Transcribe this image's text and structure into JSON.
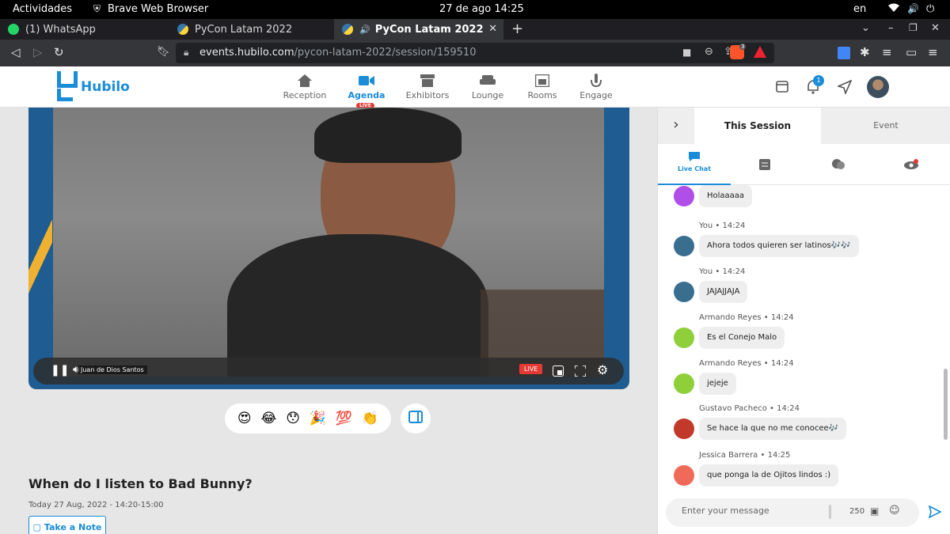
{
  "system": {
    "activities": "Actividades",
    "app_name": "Brave Web Browser",
    "datetime": "27 de ago  14:25",
    "lang": "en"
  },
  "browser": {
    "tabs": [
      {
        "title": "(1) WhatsApp"
      },
      {
        "title": "PyCon Latam 2022"
      },
      {
        "title": "PyCon Latam 2022"
      }
    ],
    "url_host": "events.hubilo.com",
    "url_path": "/pycon-latam-2022/session/159510",
    "brave_badge": "3"
  },
  "app": {
    "logo": "Hubilo",
    "nav": [
      {
        "label": "Reception",
        "icon": "home-icon"
      },
      {
        "label": "Agenda",
        "icon": "video-camera-icon",
        "badge": "LIVE"
      },
      {
        "label": "Exhibitors",
        "icon": "store-icon"
      },
      {
        "label": "Lounge",
        "icon": "sofa-icon"
      },
      {
        "label": "Rooms",
        "icon": "rooms-icon"
      },
      {
        "label": "Engage",
        "icon": "engage-icon"
      }
    ],
    "notification_count": "1"
  },
  "video": {
    "speaker_name": "Juan de Dios Santos",
    "live_label": "LIVE"
  },
  "reactions": [
    "😍",
    "😂",
    "😯",
    "🎉",
    "💯",
    "👏"
  ],
  "session": {
    "title": "When do I listen to Bad Bunny?",
    "time": "Today 27 Aug, 2022 - 14:20-15:00",
    "take_note": "Take a Note"
  },
  "panel": {
    "tab_session": "This Session",
    "tab_event": "Event",
    "live_chat": "Live Chat",
    "messages": [
      {
        "author": "",
        "time": "",
        "text": "Holaaaaa",
        "avatar_color": "#b04ee8"
      },
      {
        "author": "You",
        "time": "14:24",
        "text": "Ahora todos quieren ser latinos🎶🎶",
        "avatar_color": "#3a6e8f"
      },
      {
        "author": "You",
        "time": "14:24",
        "text": "JAJAJJAJA",
        "avatar_color": "#3a6e8f"
      },
      {
        "author": "Armando Reyes",
        "time": "14:24",
        "text": "Es el Conejo Malo",
        "avatar_color": "#8fcf3a"
      },
      {
        "author": "Armando Reyes",
        "time": "14:24",
        "text": "jejeje",
        "avatar_color": "#8fcf3a"
      },
      {
        "author": "Gustavo Pacheco",
        "time": "14:24",
        "text": "Se hace la que no me conocee🎶",
        "avatar_color": "#c0392b"
      },
      {
        "author": "Jessica Barrera",
        "time": "14:25",
        "text": "que ponga la de Ojitos lindos :)",
        "avatar_color": "#f06a5a"
      }
    ],
    "input_placeholder": "Enter your message",
    "char_count": "250"
  }
}
